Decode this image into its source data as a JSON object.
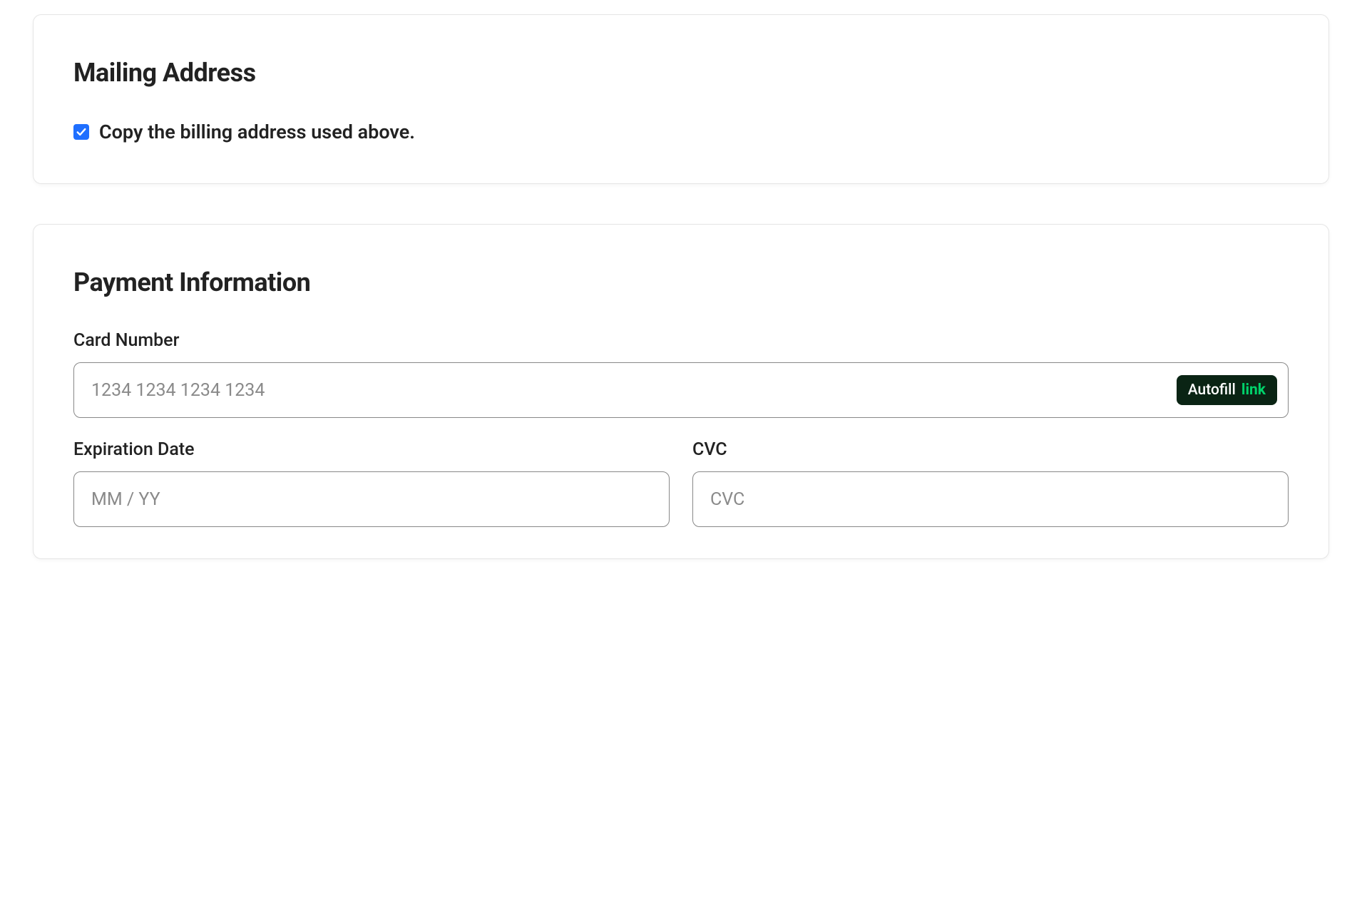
{
  "mailing": {
    "title": "Mailing Address",
    "copy_checkbox": {
      "label": "Copy the billing address used above.",
      "checked": true
    }
  },
  "payment": {
    "title": "Payment Information",
    "card_number": {
      "label": "Card Number",
      "placeholder": "1234 1234 1234 1234",
      "value": ""
    },
    "autofill": {
      "text": "Autofill",
      "link_text": "link"
    },
    "expiration": {
      "label": "Expiration Date",
      "placeholder": "MM / YY",
      "value": ""
    },
    "cvc": {
      "label": "CVC",
      "placeholder": "CVC",
      "value": ""
    }
  }
}
